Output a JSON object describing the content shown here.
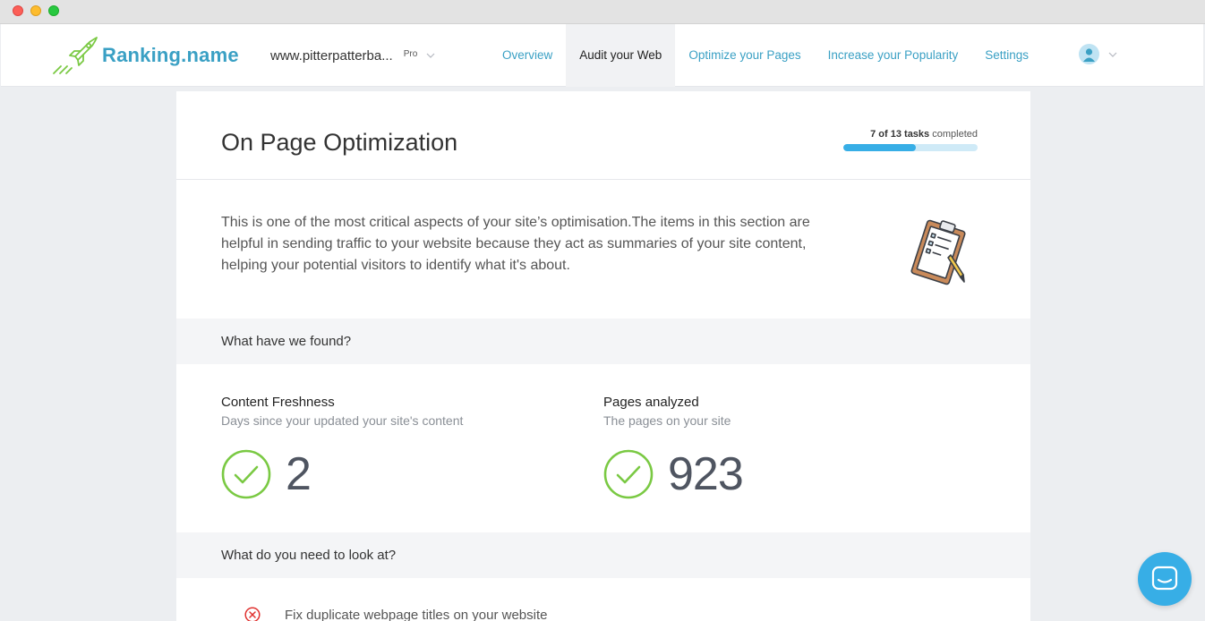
{
  "brand": {
    "name": "Ranking.name",
    "color": "#3aa0c4"
  },
  "site": {
    "url": "www.pitterpatterba...",
    "plan": "Pro"
  },
  "nav": {
    "tabs": [
      {
        "label": "Overview",
        "active": false
      },
      {
        "label": "Audit your Web",
        "active": true
      },
      {
        "label": "Optimize your Pages",
        "active": false
      },
      {
        "label": "Increase your Popularity",
        "active": false
      },
      {
        "label": "Settings",
        "active": false
      }
    ]
  },
  "page": {
    "title": "On Page Optimization",
    "progress": {
      "done": "7 of 13 tasks",
      "suffix": "completed",
      "fraction": 0.54
    },
    "intro": "This is one of the most critical aspects of your site’s optimisation.The items in this section are helpful in sending traffic to your website because they act as summaries of your site content, helping your potential visitors to identify what it's about.",
    "found_heading": "What have we found?",
    "metrics": [
      {
        "title": "Content Freshness",
        "subtitle": "Days since your updated your site's content",
        "value": "2",
        "status": "ok"
      },
      {
        "title": "Pages analyzed",
        "subtitle": "The pages on your site",
        "value": "923",
        "status": "ok"
      }
    ],
    "todo_heading": "What do you need to look at?",
    "tasks": [
      {
        "label": "Fix duplicate webpage titles on your website",
        "status": "error"
      }
    ]
  },
  "colors": {
    "accent": "#37aee6",
    "success": "#7ac943",
    "error": "#e0312f"
  },
  "icons": [
    "rocket-icon",
    "chevron-down-icon",
    "user-icon",
    "clipboard-icon",
    "check-circle-icon",
    "error-circle-icon",
    "chat-icon"
  ]
}
